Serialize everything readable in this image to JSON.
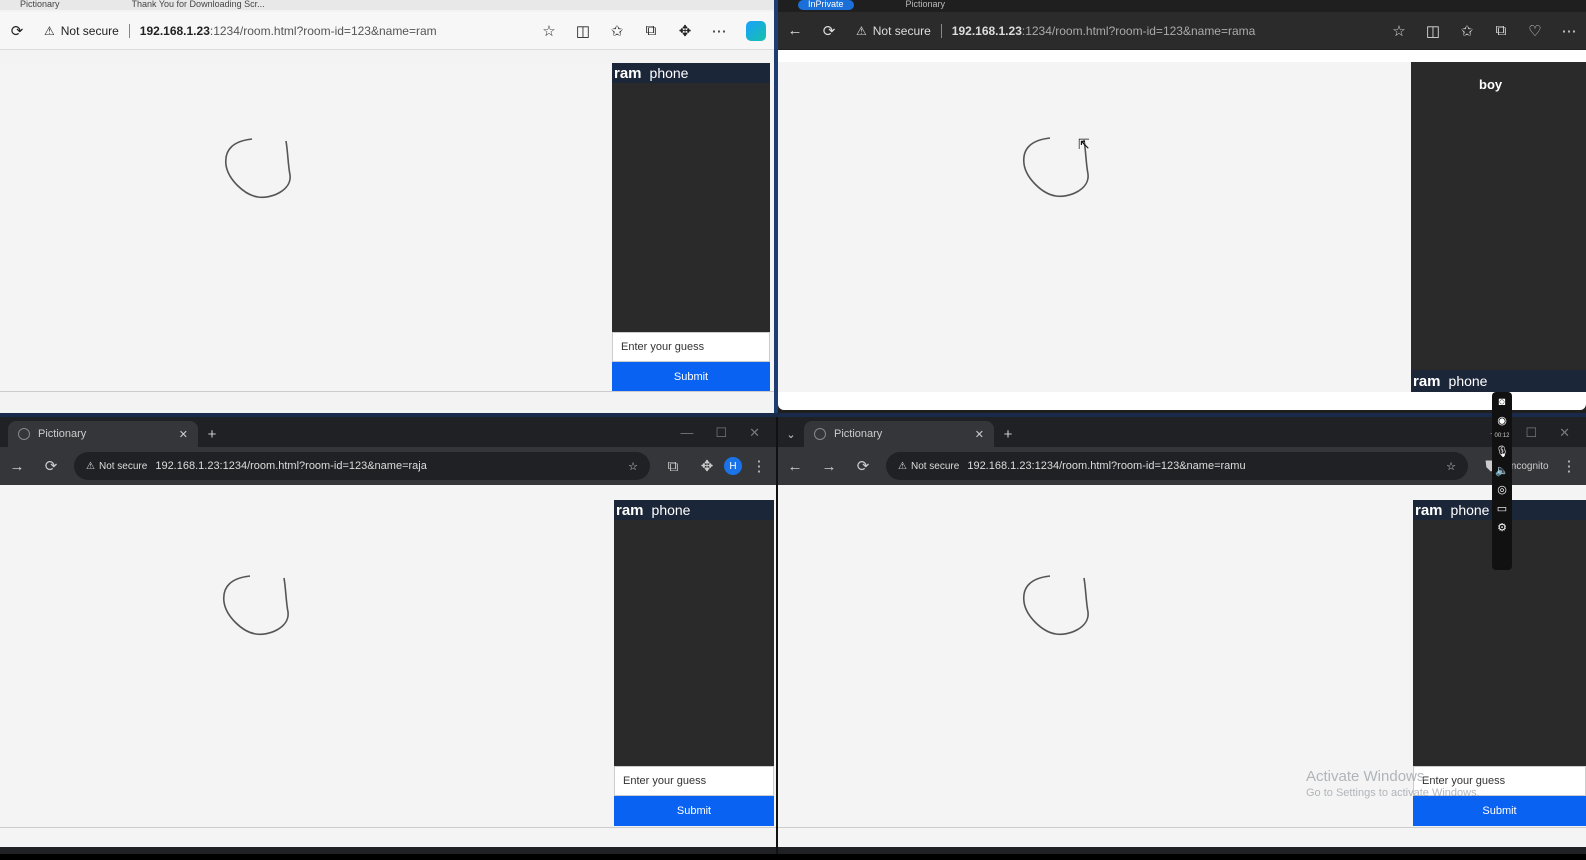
{
  "top_left": {
    "tabs": [
      "Pictionary",
      "Thank You for Downloading Scr..."
    ],
    "security": "Not secure",
    "url_host": "192.168.1.23",
    "url_rest": ":1234/room.html?room-id=123&name=ram",
    "panel": {
      "player": "ram",
      "word": "phone",
      "guess_placeholder": "Enter your guess",
      "submit": "Submit"
    }
  },
  "top_right": {
    "tabs": [
      "InPrivate",
      "Pictionary"
    ],
    "security": "Not secure",
    "url_host": "192.168.1.23",
    "url_rest": ":1234/room.html?room-id=123&name=rama",
    "guessed_word": "boy",
    "panel": {
      "player": "ram",
      "word": "phone"
    }
  },
  "bottom_left": {
    "tab": "Pictionary",
    "security": "Not secure",
    "url": "192.168.1.23:1234/room.html?room-id=123&name=raja",
    "avatar": "H",
    "panel": {
      "player": "ram",
      "word": "phone",
      "guess_placeholder": "Enter your guess",
      "submit": "Submit"
    }
  },
  "bottom_right": {
    "tab": "Pictionary",
    "security": "Not secure",
    "url": "192.168.1.23:1234/room.html?room-id=123&name=ramu",
    "incognito": "Incognito",
    "panel": {
      "player": "ram",
      "word": "phone",
      "guess_placeholder": "Enter your guess",
      "submit": "Submit"
    }
  },
  "recorder": {
    "time": "00:12"
  },
  "watermark": {
    "title": "Activate Windows",
    "subtitle": "Go to Settings to activate Windows."
  },
  "icons": [
    "back-icon",
    "forward-icon",
    "refresh-icon",
    "warning-icon",
    "star-icon",
    "split-icon",
    "favorites-icon",
    "collections-icon",
    "extensions-icon",
    "more-icon",
    "copilot-icon",
    "camera-icon",
    "record-icon",
    "mic-icon",
    "speaker-icon",
    "webcam-icon",
    "screen-icon",
    "settings-icon"
  ]
}
